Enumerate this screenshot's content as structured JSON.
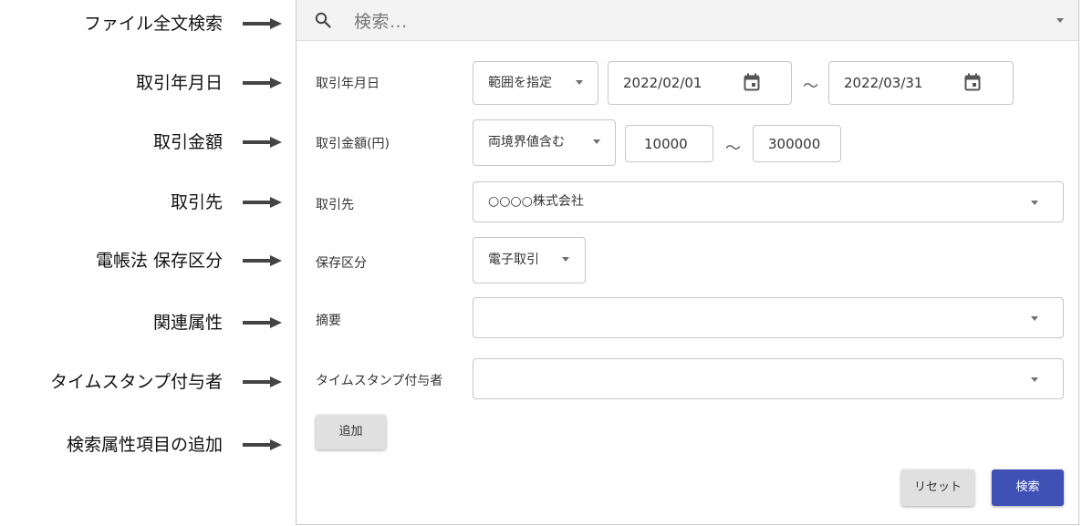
{
  "annotations": [
    {
      "key": "fulltext",
      "label": "ファイル全文検索"
    },
    {
      "key": "date",
      "label": "取引年月日"
    },
    {
      "key": "amount",
      "label": "取引金額"
    },
    {
      "key": "partner",
      "label": "取引先"
    },
    {
      "key": "storage",
      "label": "電帳法 保存区分"
    },
    {
      "key": "related",
      "label": "関連属性"
    },
    {
      "key": "timestamp",
      "label": "タイムスタンプ付与者"
    },
    {
      "key": "add",
      "label": "検索属性項目の追加"
    }
  ],
  "search": {
    "placeholder": "検索..."
  },
  "form": {
    "date": {
      "label": "取引年月日",
      "mode": "範囲を指定",
      "from": "2022/02/01",
      "to": "2022/03/31"
    },
    "amount": {
      "label": "取引金額(円)",
      "mode": "両境界値含む",
      "min": "10000",
      "max": "300000"
    },
    "partner": {
      "label": "取引先",
      "value": "○○○○株式会社"
    },
    "storage": {
      "label": "保存区分",
      "value": "電子取引"
    },
    "summary": {
      "label": "摘要",
      "value": ""
    },
    "timestamp_user": {
      "label": "タイムスタンプ付与者",
      "value": ""
    },
    "range_sep": "～"
  },
  "buttons": {
    "add": "追加",
    "reset": "リセット",
    "search": "検索"
  },
  "colors": {
    "primary": "#3f51b5",
    "annotation_arrow": "#444444"
  }
}
